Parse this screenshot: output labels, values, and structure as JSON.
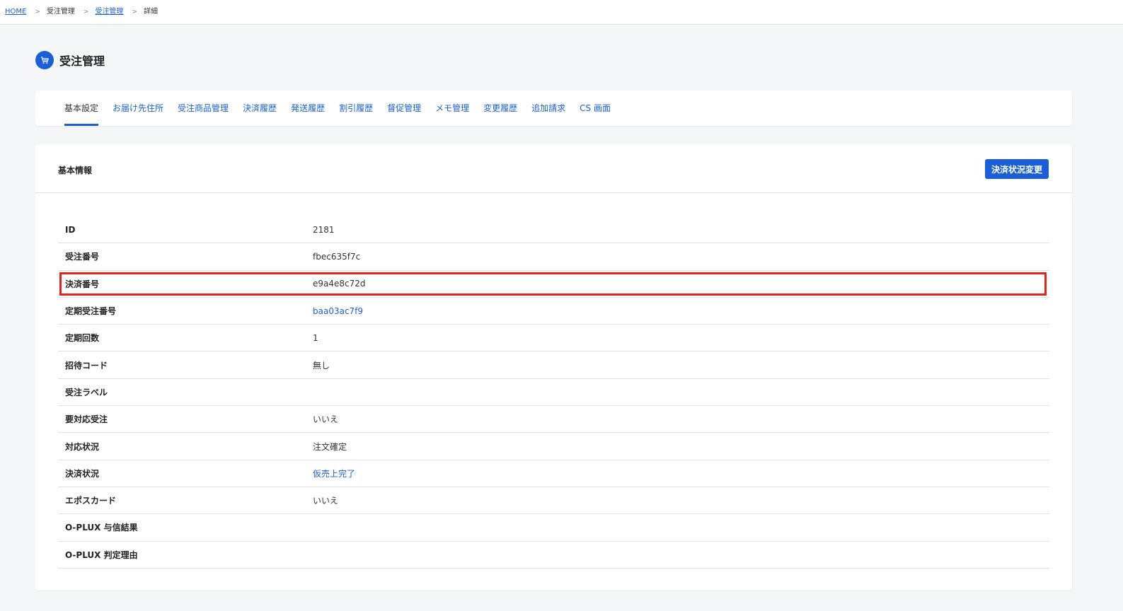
{
  "breadcrumb": {
    "home": "HOME",
    "sep": ">",
    "item1": "受注管理",
    "item2": "受注管理",
    "item3": "詳細"
  },
  "page": {
    "title": "受注管理",
    "icon": "cart-icon",
    "accent": "#1a5fd6"
  },
  "tabs": [
    {
      "label": "基本設定",
      "active": true
    },
    {
      "label": "お届け先住所"
    },
    {
      "label": "受注商品管理"
    },
    {
      "label": "決済履歴"
    },
    {
      "label": "発送履歴"
    },
    {
      "label": "割引履歴"
    },
    {
      "label": "督促管理"
    },
    {
      "label": "メモ管理"
    },
    {
      "label": "変更履歴"
    },
    {
      "label": "追加請求"
    },
    {
      "label": "CS 画面"
    }
  ],
  "card": {
    "title": "基本情報",
    "button_label": "決済状況変更"
  },
  "rows": [
    {
      "label": "ID",
      "value": "2181"
    },
    {
      "label": "受注番号",
      "value": "fbec635f7c"
    },
    {
      "label": "決済番号",
      "value": "e9a4e8c72d",
      "highlight": true
    },
    {
      "label": "定期受注番号",
      "value": "baa03ac7f9",
      "link": true
    },
    {
      "label": "定期回数",
      "value": "1"
    },
    {
      "label": "招待コード",
      "value": "無し"
    },
    {
      "label": "受注ラベル",
      "value": ""
    },
    {
      "label": "要対応受注",
      "value": "いいえ"
    },
    {
      "label": "対応状況",
      "value": "注文確定"
    },
    {
      "label": "決済状況",
      "value": "仮売上完了",
      "link": true
    },
    {
      "label": "エポスカード",
      "value": "いいえ"
    },
    {
      "label": "O-PLUX 与信結果",
      "value": ""
    },
    {
      "label": "O-PLUX 判定理由",
      "value": ""
    }
  ],
  "colors": {
    "highlight_border": "#e0261b",
    "link": "#1a5fd6"
  }
}
